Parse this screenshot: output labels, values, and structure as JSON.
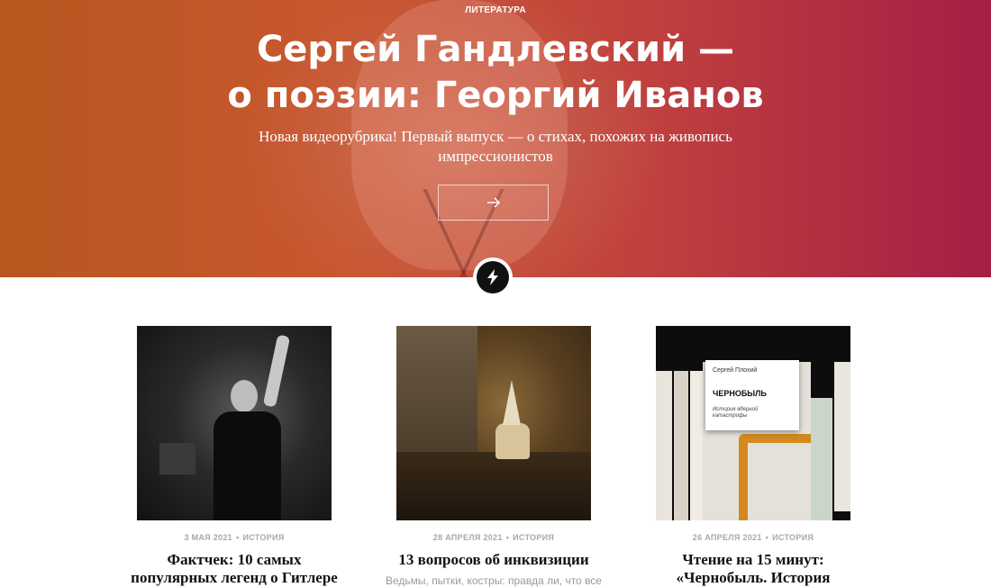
{
  "hero": {
    "kicker": "ЛИТЕРАТУРА",
    "title_line1": "Сергей Гандлевский —",
    "title_line2": "о поэзии: Георгий Иванов",
    "subtitle_line1": "Новая видеорубрика! Первый выпуск — о стихах, похожих на живопись",
    "subtitle_line2": "импрессионистов",
    "button_icon": "arrow-right-icon",
    "colors": {
      "gradient_start": "#b8571f",
      "gradient_end": "#a51e45",
      "text": "#ffffff"
    }
  },
  "divider_badge": {
    "icon": "lightning-bolt-icon",
    "color": "#111111"
  },
  "cards": [
    {
      "date": "3 МАЯ 2021",
      "category": "ИСТОРИЯ",
      "title_line1": "Фактчек: 10 самых",
      "title_line2": "популярных легенд о Гитлере",
      "description": ""
    },
    {
      "date": "28 АПРЕЛЯ 2021",
      "category": "ИСТОРИЯ",
      "title_line1": "13 вопросов об инквизиции",
      "title_line2": "",
      "description": "Ведьмы, пытки, костры: правда ли, что все"
    },
    {
      "date": "26 АПРЕЛЯ 2021",
      "category": "ИСТОРИЯ",
      "title_line1": "Чтение на 15 минут:",
      "title_line2": "«Чернобыль. История",
      "description": "",
      "cover": {
        "author": "Сергей Плохий",
        "book_title": "ЧЕРНОБЫЛЬ",
        "book_subtitle": "История ядерной катастрофы"
      }
    }
  ],
  "meta_separator": "•"
}
